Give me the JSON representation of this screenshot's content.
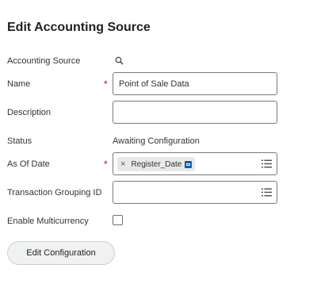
{
  "page": {
    "title": "Edit Accounting Source"
  },
  "fields": {
    "accounting_source": {
      "label": "Accounting Source",
      "icon": "search-icon"
    },
    "name": {
      "label": "Name",
      "required_mark": "*",
      "value": "Point of Sale Data"
    },
    "description": {
      "label": "Description",
      "value": ""
    },
    "status": {
      "label": "Status",
      "value": "Awaiting Configuration"
    },
    "as_of_date": {
      "label": "As Of Date",
      "required_mark": "*",
      "tag": {
        "remove": "×",
        "text": "Register_Date"
      }
    },
    "transaction_grouping_id": {
      "label": "Transaction Grouping ID",
      "value": ""
    },
    "enable_multicurrency": {
      "label": "Enable Multicurrency",
      "checked": false
    }
  },
  "actions": {
    "edit_configuration": "Edit Configuration"
  },
  "colors": {
    "required": "#d0021b",
    "badge": "#0b5fa8"
  }
}
